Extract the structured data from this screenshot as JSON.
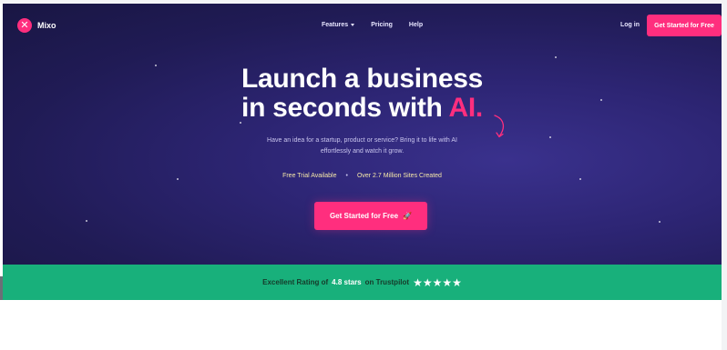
{
  "brand": {
    "name": "Mixo",
    "logo_glyph": "✕"
  },
  "nav": {
    "links": [
      "Features",
      "Pricing",
      "Help"
    ],
    "login": "Log in",
    "cta": "Get Started for Free"
  },
  "hero": {
    "headline_line1": "Launch a business",
    "headline_line2_prefix": "in seconds with ",
    "headline_accent": "AI.",
    "subtext_line1": "Have an idea for a startup, product or service? Bring it to life with AI",
    "subtext_line2": "effortlessly and watch it grow.",
    "feature1": "Free Trial Available",
    "separator": "•",
    "feature2": "Over 2.7 Million Sites Created",
    "cta": "Get Started for Free",
    "cta_icon": "🚀"
  },
  "rating": {
    "prefix": "Excellent Rating of",
    "score": "4.8 stars",
    "suffix": "on Trustpilot",
    "stars": "★★★★★"
  },
  "colors": {
    "accent": "#ff2e7e",
    "hero_bg": "#2d2574",
    "rating_bar": "#18b07b"
  }
}
